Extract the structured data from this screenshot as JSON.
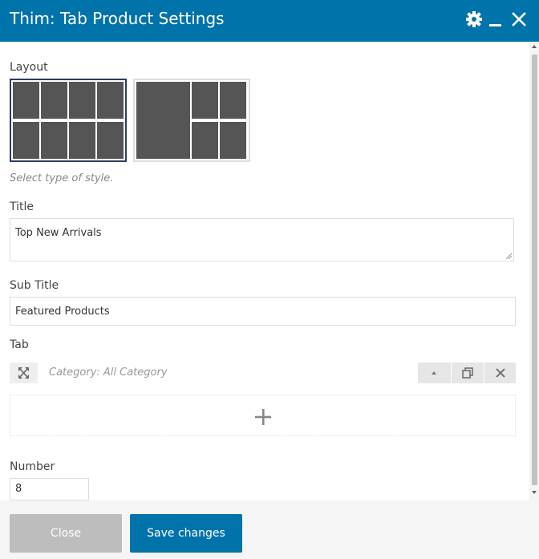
{
  "dialog": {
    "title": "Thim: Tab Product Settings",
    "header_color": "#0073aa",
    "icons": [
      "gear-icon",
      "minimize-icon",
      "close-icon"
    ]
  },
  "form": {
    "layout": {
      "label": "Layout",
      "options": [
        "grid-4x2",
        "featured-left-grid"
      ],
      "selected": "grid-4x2",
      "hint": "Select type of style."
    },
    "title": {
      "label": "Title",
      "value": "Top New Arrivals"
    },
    "sub_title": {
      "label": "Sub Title",
      "value": "Featured Products"
    },
    "tab": {
      "label": "Tab",
      "items": [
        {
          "title": "Category: All Category"
        }
      ],
      "add_icon": "plus-icon"
    },
    "number": {
      "label": "Number",
      "value": "8"
    }
  },
  "footer": {
    "close_label": "Close",
    "save_label": "Save changes"
  }
}
